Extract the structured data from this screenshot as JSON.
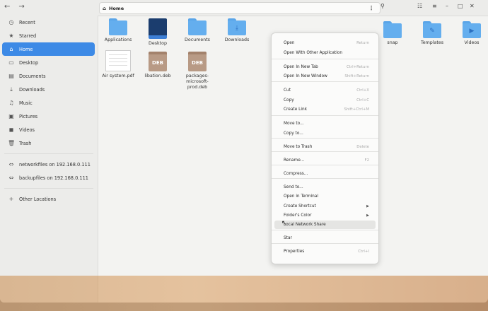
{
  "sidebar": {
    "items": [
      {
        "icon": "clock-icon",
        "glyph": "◷",
        "label": "Recent"
      },
      {
        "icon": "star-icon",
        "glyph": "★",
        "label": "Starred"
      },
      {
        "icon": "home-icon",
        "glyph": "⌂",
        "label": "Home",
        "active": true
      },
      {
        "icon": "desktop-icon",
        "glyph": "▭",
        "label": "Desktop"
      },
      {
        "icon": "document-icon",
        "glyph": "▤",
        "label": "Documents"
      },
      {
        "icon": "download-icon",
        "glyph": "⤓",
        "label": "Downloads"
      },
      {
        "icon": "music-icon",
        "glyph": "♫",
        "label": "Music"
      },
      {
        "icon": "picture-icon",
        "glyph": "▣",
        "label": "Pictures"
      },
      {
        "icon": "video-icon",
        "glyph": "◼",
        "label": "Videos"
      },
      {
        "icon": "trash-icon",
        "glyph": "🗑",
        "label": "Trash"
      }
    ],
    "network": [
      {
        "label": "networkfiles on 192.168.0.111"
      },
      {
        "label": "backupfiles on 192.168.0.111"
      }
    ],
    "other_locations": "Other Locations"
  },
  "header": {
    "path": "Home"
  },
  "files": [
    {
      "kind": "folder",
      "label": "Applications"
    },
    {
      "kind": "app",
      "label": "Desktop"
    },
    {
      "kind": "folder",
      "label": "Documents"
    },
    {
      "kind": "folder-download",
      "label": "Downloads"
    },
    {
      "kind": "folder",
      "label": "snap"
    },
    {
      "kind": "folder-templates",
      "label": "Templates"
    },
    {
      "kind": "folder-video",
      "label": "Videos"
    },
    {
      "kind": "pdf",
      "label": "Air system.pdf"
    },
    {
      "kind": "deb",
      "label": "libation.deb",
      "badge": "DEB"
    },
    {
      "kind": "deb",
      "label": "packages-microsoft-prod.deb",
      "badge": "DEB"
    }
  ],
  "menu": [
    {
      "label": "Open",
      "shortcut": "Return"
    },
    {
      "label": "Open With Other Application",
      "shortcut": ""
    },
    {
      "label": "Open In New Tab",
      "shortcut": "Ctrl+Return"
    },
    {
      "label": "Open In New Window",
      "shortcut": "Shift+Return"
    },
    {
      "label": "Cut",
      "shortcut": "Ctrl+X"
    },
    {
      "label": "Copy",
      "shortcut": "Ctrl+C"
    },
    {
      "label": "Create Link",
      "shortcut": "Shift+Ctrl+M"
    },
    {
      "label": "Move to...",
      "shortcut": ""
    },
    {
      "label": "Copy to...",
      "shortcut": ""
    },
    {
      "label": "Move to Trash",
      "shortcut": "Delete"
    },
    {
      "label": "Rename...",
      "shortcut": "F2"
    },
    {
      "label": "Compress...",
      "shortcut": ""
    },
    {
      "label": "Send to...",
      "shortcut": ""
    },
    {
      "label": "Open in Terminal",
      "shortcut": ""
    },
    {
      "label": "Create Shortcut",
      "shortcut": "",
      "submenu": true
    },
    {
      "label": "Folder's Color",
      "shortcut": "",
      "submenu": true
    },
    {
      "label": "Local Network Share",
      "shortcut": "",
      "highlight": true
    },
    {
      "label": "Star",
      "shortcut": ""
    },
    {
      "label": "Properties",
      "shortcut": "Ctrl+I"
    }
  ]
}
